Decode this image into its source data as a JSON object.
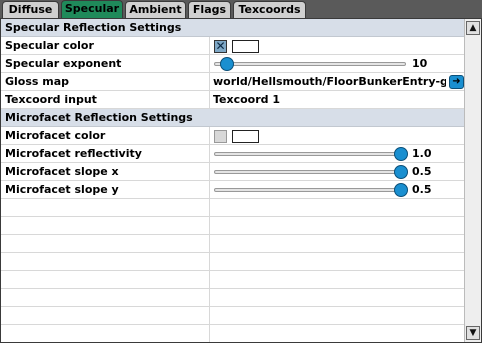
{
  "tabs": [
    {
      "label": "Diffuse",
      "active": false
    },
    {
      "label": "Specular",
      "active": true
    },
    {
      "label": "Ambient",
      "active": false
    },
    {
      "label": "Flags",
      "active": false
    },
    {
      "label": "Texcoords",
      "active": false
    }
  ],
  "sections": {
    "specular_header": "Specular Reflection Settings",
    "microfacet_header": "Microfacet Reflection Settings"
  },
  "properties": {
    "specular_color": {
      "label": "Specular color",
      "checked": true,
      "swatch": "#ffffff"
    },
    "specular_exponent": {
      "label": "Specular exponent",
      "value": "10",
      "level": 0.0
    },
    "gloss_map": {
      "label": "Gloss map",
      "value": "world/Hellsmouth/FloorBunkerEntry-glos"
    },
    "texcoord_input": {
      "label": "Texcoord input",
      "value": "Texcoord 1"
    },
    "microfacet_color": {
      "label": "Microfacet color",
      "checked": false,
      "swatch": "#ffffff"
    },
    "microfacet_reflectivity": {
      "label": "Microfacet reflectivity",
      "value": "1.0",
      "level": 1.0
    },
    "microfacet_slope_x": {
      "label": "Microfacet slope x",
      "value": "0.5",
      "level": 1.0
    },
    "microfacet_slope_y": {
      "label": "Microfacet slope y",
      "value": "0.5",
      "level": 1.0
    }
  },
  "icons": {
    "check": "check-x-icon",
    "browse": "arrow-right-icon",
    "scroll_up": "up-arrow-icon",
    "scroll_down": "down-arrow-icon"
  },
  "colors": {
    "active_tab": "#1f8a5a",
    "section_header": "#d7dee8",
    "slider_knob": "#1a8fd0"
  }
}
